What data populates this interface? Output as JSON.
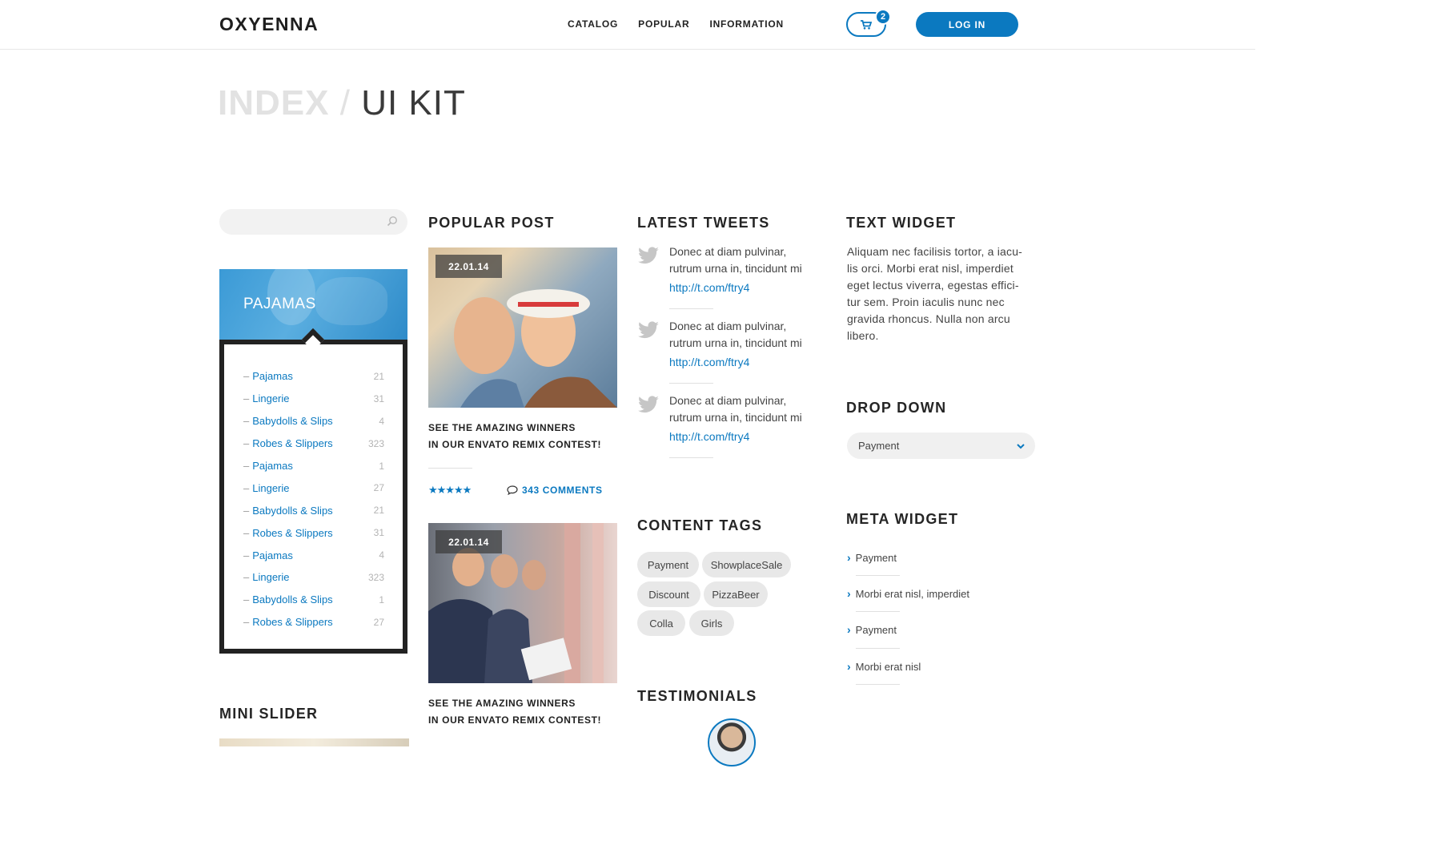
{
  "header": {
    "logo": "OXYENNA",
    "nav": [
      "CATALOG",
      "POPULAR",
      "INFORMATION"
    ],
    "cart_count": "2",
    "login_label": "LOG IN"
  },
  "page_title": {
    "crumb": "INDEX",
    "separator": "/",
    "current": "UI KIT"
  },
  "search": {
    "placeholder": ""
  },
  "categories": {
    "banner": "PAJAMAS",
    "items": [
      {
        "label": "Pajamas",
        "count": "21"
      },
      {
        "label": "Lingerie",
        "count": "31"
      },
      {
        "label": "Babydolls & Slips",
        "count": "4"
      },
      {
        "label": "Robes & Slippers",
        "count": "323"
      },
      {
        "label": "Pajamas",
        "count": "1"
      },
      {
        "label": "Lingerie",
        "count": "27"
      },
      {
        "label": "Babydolls & Slips",
        "count": "21"
      },
      {
        "label": "Robes & Slippers",
        "count": "31"
      },
      {
        "label": "Pajamas",
        "count": "4"
      },
      {
        "label": "Lingerie",
        "count": "323"
      },
      {
        "label": "Babydolls & Slips",
        "count": "1"
      },
      {
        "label": "Robes & Slippers",
        "count": "27"
      }
    ]
  },
  "mini_slider": {
    "heading": "MINI SLIDER"
  },
  "popular_post": {
    "heading": "POPULAR POST",
    "posts": [
      {
        "date": "22.01.14",
        "title_line1": "SEE THE AMAZING WINNERS",
        "title_line2": "IN OUR ENVATO REMIX CONTEST!",
        "stars": 5,
        "comments": "343 COMMENTS"
      },
      {
        "date": "22.01.14",
        "title_line1": "SEE THE AMAZING WINNERS",
        "title_line2": "IN OUR ENVATO REMIX CONTEST!"
      }
    ]
  },
  "latest_tweets": {
    "heading": "LATEST TWEETS",
    "tweets": [
      {
        "line1": "Donec at diam pulvinar,",
        "line2": "rutrum urna in, tincidunt mi",
        "link": "http://t.com/ftry4"
      },
      {
        "line1": "Donec at diam pulvinar,",
        "line2": "rutrum urna in, tincidunt mi",
        "link": "http://t.com/ftry4"
      },
      {
        "line1": "Donec at diam pulvinar,",
        "line2": "rutrum urna in, tincidunt mi",
        "link": "http://t.com/ftry4"
      }
    ]
  },
  "content_tags": {
    "heading": "CONTENT TAGS",
    "tags": [
      "Payment",
      "ShowplaceSale",
      "Discount",
      "PizzaBeer",
      "Colla",
      "Girls"
    ]
  },
  "testimonials": {
    "heading": "TESTIMONIALS"
  },
  "text_widget": {
    "heading": "TEXT WIDGET",
    "lines": [
      "Aliquam nec facilisis tortor, a iacu-",
      "lis orci. Morbi erat nisl, imperdiet",
      "eget lectus viverra, egestas effici-",
      "tur sem. Proin iaculis nunc nec",
      "gravida rhoncus. Nulla non arcu",
      "libero."
    ]
  },
  "drop_down": {
    "heading": "DROP DOWN",
    "selected": "Payment"
  },
  "meta_widget": {
    "heading": "META WIDGET",
    "items": [
      "Payment",
      "Morbi erat nisl, imperdiet",
      "Payment",
      "Morbi erat nisl"
    ]
  },
  "colors": {
    "accent": "#0b79c0",
    "text": "#2d2d2d",
    "muted": "#b3b3b3"
  }
}
